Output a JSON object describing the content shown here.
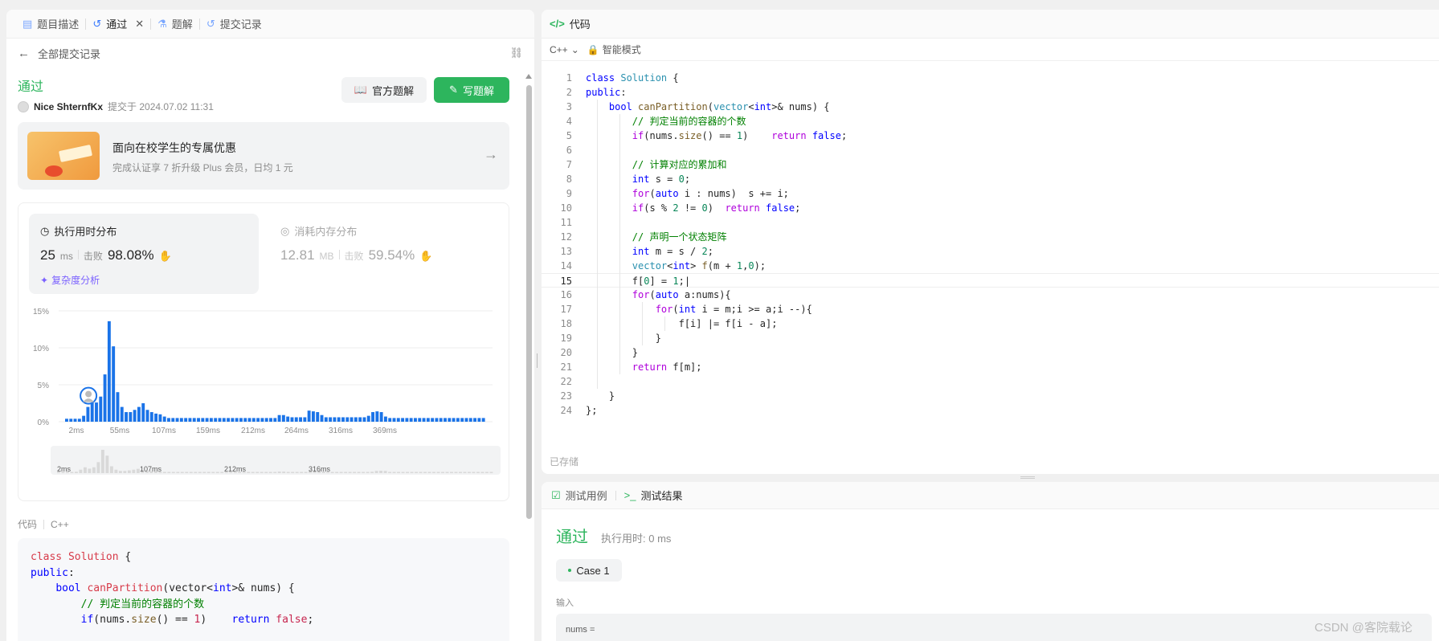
{
  "left_panel": {
    "tabs": [
      {
        "label": "题目描述"
      },
      {
        "label": "通过"
      },
      {
        "label": "题解"
      },
      {
        "label": "提交记录"
      }
    ],
    "back_label": "全部提交记录",
    "status": "通过",
    "user": "Nice ShternfKx",
    "submitted_at": "提交于 2024.07.02 11:31",
    "btn_official": "官方题解",
    "btn_write": "写题解",
    "promo": {
      "title": "面向在校学生的专属优惠",
      "subtitle": "完成认证享 7 折升级 Plus 会员，日均 1 元"
    },
    "runtime": {
      "title": "执行用时分布",
      "value": "25",
      "unit": "ms",
      "beat_label": "击败",
      "beat_pct": "98.08%",
      "complexity": "复杂度分析"
    },
    "memory": {
      "title": "消耗内存分布",
      "value": "12.81",
      "unit": "MB",
      "beat_label": "击败",
      "beat_pct": "59.54%"
    },
    "code_label": "代码",
    "code_lang": "C++"
  },
  "chart_data": {
    "type": "bar",
    "title": "",
    "xlabel": "",
    "ylabel": "",
    "ylim": [
      0,
      15
    ],
    "y_ticks": [
      "0%",
      "5%",
      "10%",
      "15%"
    ],
    "x_ticks": [
      "2ms",
      "55ms",
      "107ms",
      "159ms",
      "212ms",
      "264ms",
      "316ms",
      "369ms"
    ],
    "values": [
      0.4,
      0.4,
      0.4,
      0.4,
      0.8,
      2.0,
      3.4,
      2.6,
      3.4,
      6.4,
      13.6,
      10.2,
      4.0,
      2.0,
      1.3,
      1.3,
      1.6,
      2.0,
      2.5,
      1.6,
      1.3,
      1.1,
      1.0,
      0.7,
      0.5,
      0.5,
      0.5,
      0.5,
      0.5,
      0.5,
      0.5,
      0.5,
      0.5,
      0.5,
      0.5,
      0.5,
      0.5,
      0.5,
      0.5,
      0.5,
      0.5,
      0.5,
      0.5,
      0.5,
      0.5,
      0.5,
      0.5,
      0.5,
      0.5,
      0.5,
      0.9,
      0.9,
      0.7,
      0.6,
      0.6,
      0.6,
      0.6,
      1.5,
      1.4,
      1.3,
      0.9,
      0.6,
      0.6,
      0.6,
      0.6,
      0.6,
      0.6,
      0.6,
      0.6,
      0.6,
      0.6,
      0.8,
      1.3,
      1.4,
      1.3,
      0.7,
      0.5,
      0.5,
      0.5,
      0.5,
      0.5,
      0.5,
      0.5,
      0.5,
      0.5,
      0.5,
      0.5,
      0.5,
      0.5,
      0.5,
      0.5,
      0.5,
      0.5,
      0.5,
      0.5,
      0.5,
      0.5,
      0.5,
      0.5
    ],
    "highlight_index": 5,
    "overview_ticks": [
      "2ms",
      "107ms",
      "212ms",
      "316ms"
    ],
    "colors": {
      "bar": "#1a73e8",
      "overview_bar": "#d9d9d9",
      "grid": "#eeeeee"
    }
  },
  "left_code": [
    [
      [
        "cls",
        "class "
      ],
      [
        "cls",
        "Solution "
      ],
      [
        "p",
        "{"
      ]
    ],
    [
      [
        "kw",
        "public"
      ],
      [
        "p",
        ":"
      ]
    ],
    [
      [
        "p",
        "    "
      ],
      [
        "kw",
        "bool "
      ],
      [
        "cls",
        "canPartition"
      ],
      [
        "p",
        "(vector<"
      ],
      [
        "kw",
        "int"
      ],
      [
        "p",
        ">& nums) {"
      ]
    ],
    [
      [
        "p",
        "        "
      ],
      [
        "cm",
        "// 判定当前的容器的个数"
      ]
    ],
    [
      [
        "p",
        "        "
      ],
      [
        "kw",
        "if"
      ],
      [
        "p",
        "(nums."
      ],
      [
        "fn",
        "size"
      ],
      [
        "p",
        "() == "
      ],
      [
        "red",
        "1"
      ],
      [
        "p",
        ")    "
      ],
      [
        "kw",
        "return "
      ],
      [
        "red",
        "false"
      ],
      [
        "p",
        ";"
      ]
    ]
  ],
  "editor": {
    "tab": "代码",
    "lang": "C++",
    "mode": "智能模式",
    "saved": "已存储",
    "current_line": 15,
    "lines": [
      [
        [
          "kw",
          "class "
        ],
        [
          "ty",
          "Solution "
        ],
        [
          "p",
          "{"
        ]
      ],
      [
        [
          "kw",
          "public"
        ],
        [
          "p",
          ":"
        ]
      ],
      [
        [
          "p",
          "    "
        ],
        [
          "kw",
          "bool "
        ],
        [
          "fn",
          "canPartition"
        ],
        [
          "p",
          "("
        ],
        [
          "ty",
          "vector"
        ],
        [
          "p",
          "<"
        ],
        [
          "kw",
          "int"
        ],
        [
          "p",
          ">& nums) {"
        ]
      ],
      [
        [
          "p",
          "        "
        ],
        [
          "cm",
          "// 判定当前的容器的个数"
        ]
      ],
      [
        [
          "p",
          "        "
        ],
        [
          "kw2",
          "if"
        ],
        [
          "p",
          "(nums."
        ],
        [
          "fn",
          "size"
        ],
        [
          "p",
          "() == "
        ],
        [
          "num",
          "1"
        ],
        [
          "p",
          ")    "
        ],
        [
          "kw2",
          "return "
        ],
        [
          "kw",
          "false"
        ],
        [
          "p",
          ";"
        ]
      ],
      [
        [
          "p",
          ""
        ]
      ],
      [
        [
          "p",
          "        "
        ],
        [
          "cm",
          "// 计算对应的累加和"
        ]
      ],
      [
        [
          "p",
          "        "
        ],
        [
          "kw",
          "int "
        ],
        [
          "p",
          "s = "
        ],
        [
          "num",
          "0"
        ],
        [
          "p",
          ";"
        ]
      ],
      [
        [
          "p",
          "        "
        ],
        [
          "kw2",
          "for"
        ],
        [
          "p",
          "("
        ],
        [
          "kw",
          "auto "
        ],
        [
          "p",
          "i : nums)  s += i;"
        ]
      ],
      [
        [
          "p",
          "        "
        ],
        [
          "kw2",
          "if"
        ],
        [
          "p",
          "(s % "
        ],
        [
          "num",
          "2"
        ],
        [
          "p",
          " != "
        ],
        [
          "num",
          "0"
        ],
        [
          "p",
          ")  "
        ],
        [
          "kw2",
          "return "
        ],
        [
          "kw",
          "false"
        ],
        [
          "p",
          ";"
        ]
      ],
      [
        [
          "p",
          ""
        ]
      ],
      [
        [
          "p",
          "        "
        ],
        [
          "cm",
          "// 声明一个状态矩阵"
        ]
      ],
      [
        [
          "p",
          "        "
        ],
        [
          "kw",
          "int "
        ],
        [
          "p",
          "m = s / "
        ],
        [
          "num",
          "2"
        ],
        [
          "p",
          ";"
        ]
      ],
      [
        [
          "p",
          "        "
        ],
        [
          "ty",
          "vector"
        ],
        [
          "p",
          "<"
        ],
        [
          "kw",
          "int"
        ],
        [
          "p",
          "> "
        ],
        [
          "fn",
          "f"
        ],
        [
          "p",
          "(m + "
        ],
        [
          "num",
          "1"
        ],
        [
          "p",
          ","
        ],
        [
          "num",
          "0"
        ],
        [
          "p",
          ");"
        ]
      ],
      [
        [
          "p",
          "        f["
        ],
        [
          "num",
          "0"
        ],
        [
          "p",
          "] = "
        ],
        [
          "num",
          "1"
        ],
        [
          "p",
          ";"
        ]
      ],
      [
        [
          "p",
          "        "
        ],
        [
          "kw2",
          "for"
        ],
        [
          "p",
          "("
        ],
        [
          "kw",
          "auto "
        ],
        [
          "p",
          "a:nums){"
        ]
      ],
      [
        [
          "p",
          "            "
        ],
        [
          "kw2",
          "for"
        ],
        [
          "p",
          "("
        ],
        [
          "kw",
          "int "
        ],
        [
          "p",
          "i = m;i >= a;i --){"
        ]
      ],
      [
        [
          "p",
          "                f[i] |= f[i - a];"
        ]
      ],
      [
        [
          "p",
          "            }"
        ]
      ],
      [
        [
          "p",
          "        }"
        ]
      ],
      [
        [
          "p",
          "        "
        ],
        [
          "kw2",
          "return "
        ],
        [
          "p",
          "f[m];"
        ]
      ],
      [
        [
          "p",
          ""
        ]
      ],
      [
        [
          "p",
          "    }"
        ]
      ],
      [
        [
          "p",
          "};"
        ]
      ]
    ]
  },
  "test_panel": {
    "tab_cases": "测试用例",
    "tab_result": "测试结果",
    "status": "通过",
    "runtime": "执行用时: 0 ms",
    "case": "Case 1",
    "input_label": "输入",
    "input_value": "nums ="
  },
  "watermark": "CSDN @客院载论"
}
